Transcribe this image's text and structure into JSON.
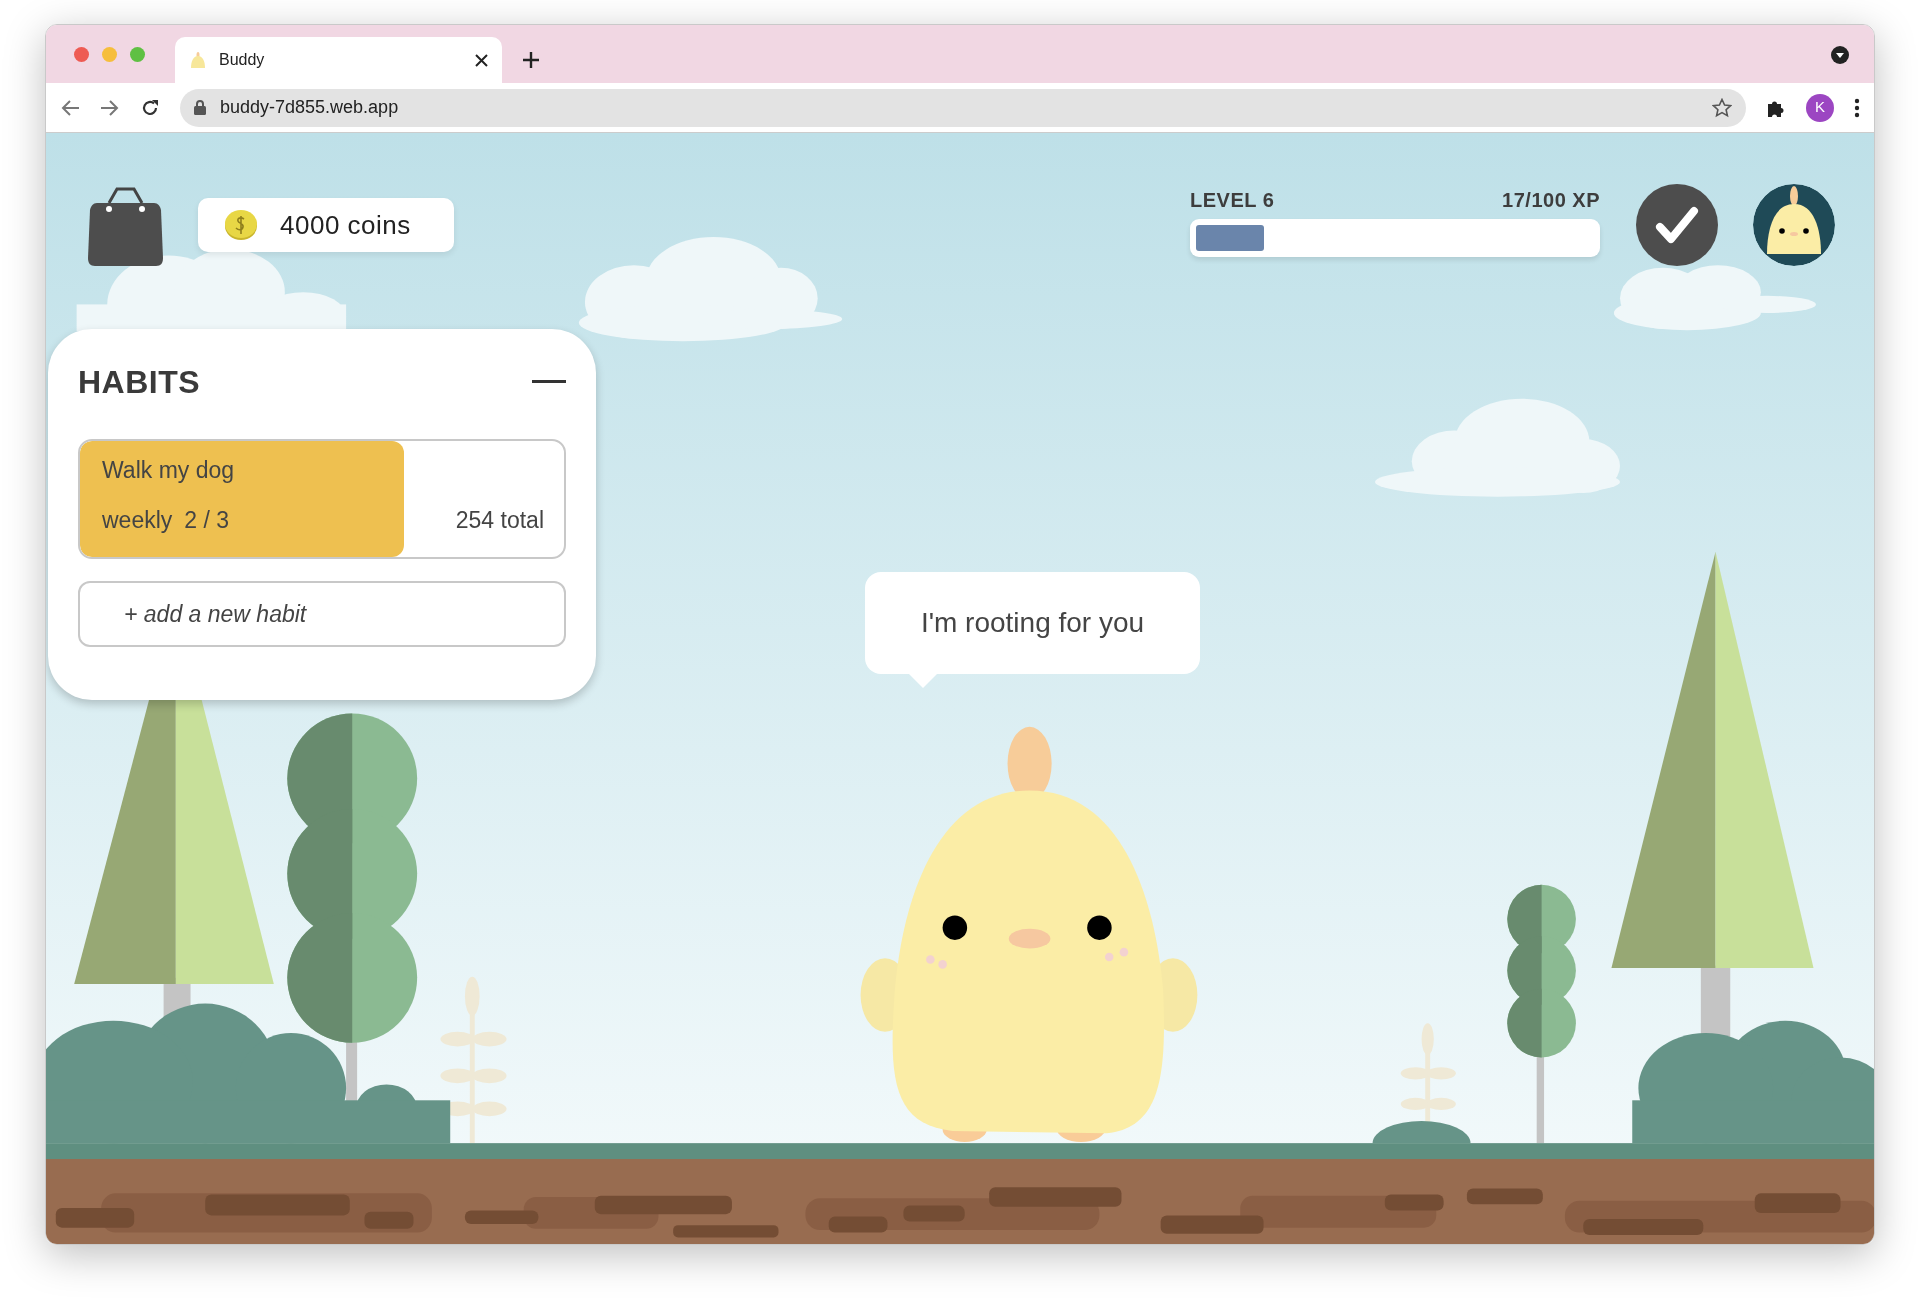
{
  "browser": {
    "tabs": [
      {
        "title": "Buddy",
        "selected": true
      }
    ],
    "url": "buddy-7d855.web.app",
    "profile_initial": "K"
  },
  "hud": {
    "coins": "4000 coins",
    "level_label": "LEVEL 6",
    "xp": "17/100 XP",
    "xp_bar": {
      "level": 0.17
    }
  },
  "habits_panel": {
    "title": "HABITS",
    "habits": [
      {
        "name": "Walk my dog",
        "frequency": "weekly",
        "progress": "2 / 3",
        "total": "254 total",
        "level": 0.67
      }
    ],
    "add_button": "+ add a new habit"
  },
  "speech_bubble": "I'm rooting for you"
}
